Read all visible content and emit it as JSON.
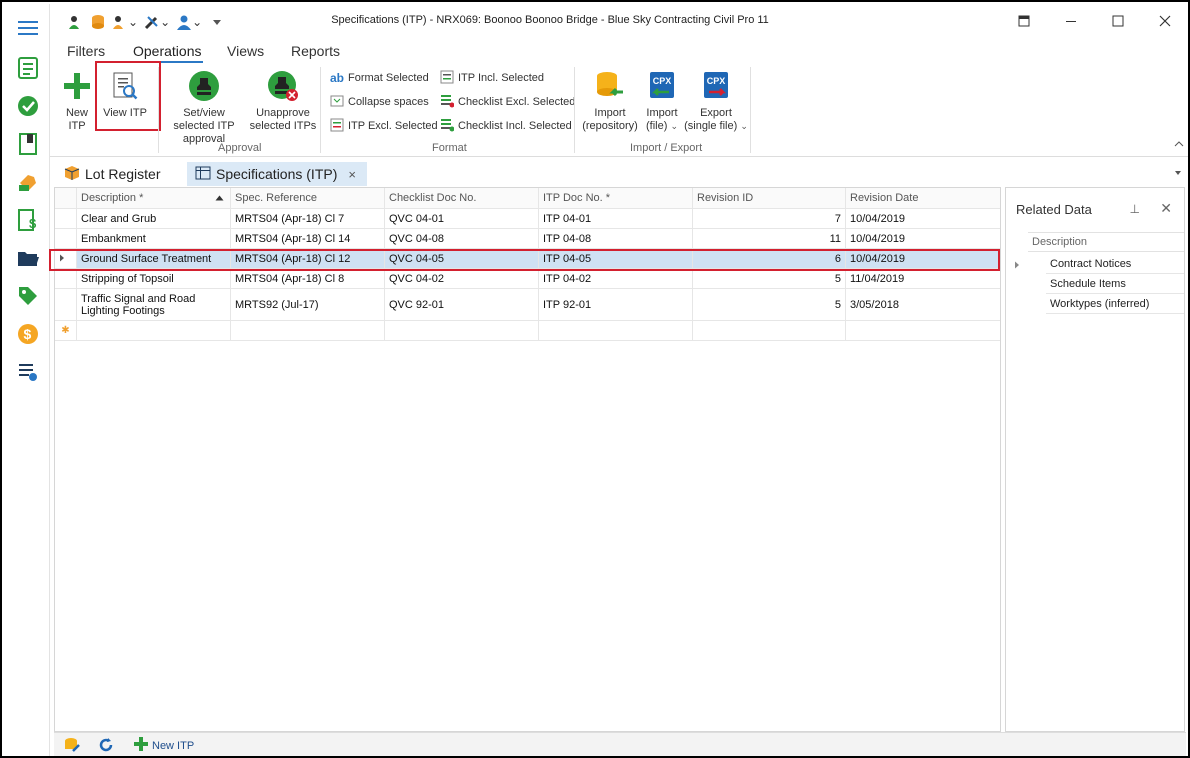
{
  "window": {
    "title": "Specifications (ITP) - NRX069: Boonoo Boonoo Bridge  - Blue Sky Contracting Civil Pro 11",
    "minimize_icon": "minimize-icon",
    "maximize_icon": "maximize-icon",
    "close_icon": "close-icon"
  },
  "ribbon_tabs": [
    "Filters",
    "Operations",
    "Views",
    "Reports"
  ],
  "ribbon": {
    "new_itp": "New ITP",
    "view_itp": "View ITP",
    "set_view_approval": "Set/view selected ITP approval",
    "unapprove": "Unapprove selected ITPs",
    "approval_group": "Approval",
    "format_selected": "Format Selected",
    "collapse_spaces": "Collapse spaces",
    "itp_excl_selected": "ITP Excl. Selected",
    "itp_incl_selected": "ITP Incl. Selected",
    "checklist_excl_selected": "Checklist Excl. Selected",
    "checklist_incl_selected": "Checklist Incl. Selected",
    "format_group": "Format",
    "import_repo": "Import (repository)",
    "import_file": "Import (file)",
    "export_single": "Export (single file)",
    "import_export_group": "Import / Export",
    "ab_glyph": "ab",
    "cpx_glyph": "CPX"
  },
  "doc_tabs": {
    "lot_register": "Lot Register",
    "specifications": "Specifications (ITP)",
    "close_glyph": "×"
  },
  "grid": {
    "columns": [
      "Description *",
      "Spec. Reference",
      "Checklist Doc No.",
      "ITP Doc No. *",
      "Revision ID",
      "Revision Date"
    ],
    "rows": [
      {
        "description": "Clear and Grub",
        "spec": "MRTS04 (Apr-18) Cl 7",
        "checklist": "QVC 04-01",
        "itp": "ITP 04-01",
        "revision": "7",
        "date": "10/04/2019"
      },
      {
        "description": "Embankment",
        "spec": "MRTS04 (Apr-18) Cl 14",
        "checklist": "QVC 04-08",
        "itp": "ITP 04-08",
        "revision": "11",
        "date": "10/04/2019"
      },
      {
        "description": "Ground Surface Treatment",
        "spec": "MRTS04 (Apr-18) Cl 12",
        "checklist": "QVC 04-05",
        "itp": "ITP 04-05",
        "revision": "6",
        "date": "10/04/2019"
      },
      {
        "description": "Stripping of Topsoil",
        "spec": "MRTS04 (Apr-18) Cl 8",
        "checklist": "QVC 04-02",
        "itp": "ITP 04-02",
        "revision": "5",
        "date": "11/04/2019"
      },
      {
        "description": "Traffic Signal and Road Lighting Footings",
        "spec": "MRTS92 (Jul-17)",
        "checklist": "QVC 92-01",
        "itp": "ITP 92-01",
        "revision": "5",
        "date": "3/05/2018"
      }
    ],
    "new_row_marker": "✱"
  },
  "related": {
    "title": "Related Data",
    "pin_glyph": "⊥",
    "close_glyph": "✕",
    "column": "Description",
    "items": [
      "Contract Notices",
      "Schedule Items",
      "Worktypes (inferred)"
    ]
  },
  "bottom": {
    "new_itp": "New ITP"
  },
  "colors": {
    "accent": "#2b78c5",
    "highlight": "#d3202f",
    "selected_row": "#cfe1f3",
    "green": "#2e9e3e"
  }
}
